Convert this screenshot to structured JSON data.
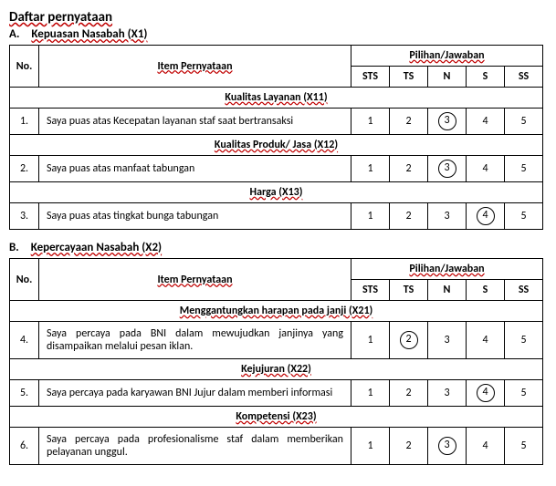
{
  "title": "Daftar pernyataan",
  "header": {
    "no": "No.",
    "item": "Item Pernyataan",
    "options_header": "Pilihan/Jawaban",
    "options": [
      "STS",
      "TS",
      "N",
      "S",
      "SS"
    ]
  },
  "scale": [
    "1",
    "2",
    "3",
    "4",
    "5"
  ],
  "sections": [
    {
      "letter": "A.",
      "title": "Kepuasan Nasabah (X1)",
      "groups": [
        {
          "subtitle": "Kualitas Layanan (X11)",
          "rows": [
            {
              "no": "1.",
              "text": "Saya puas atas Kecepatan  layanan staf saat bertransaksi",
              "circled": 3
            }
          ]
        },
        {
          "subtitle": "Kualitas Produk/ Jasa (X12)",
          "rows": [
            {
              "no": "2.",
              "text": "Saya puas atas manfaat tabungan",
              "circled": 3
            }
          ]
        },
        {
          "subtitle": "Harga (X13)",
          "rows": [
            {
              "no": "3.",
              "text": "Saya puas atas tingkat bunga tabungan",
              "circled": 4
            }
          ]
        }
      ]
    },
    {
      "letter": "B.",
      "title": "Kepercayaan Nasabah (X2)",
      "groups": [
        {
          "subtitle": "Menggantungkan harapan pada janji (X21)",
          "rows": [
            {
              "no": "4.",
              "text": "Saya percaya pada BNI dalam mewujudkan janjinya yang disampaikan melalui pesan iklan.",
              "circled": 2
            }
          ]
        },
        {
          "subtitle": "Kejujuran (X22)",
          "rows": [
            {
              "no": "5.",
              "text": "Saya percaya pada karyawan BNI Jujur dalam memberi informasi",
              "circled": 4
            }
          ]
        },
        {
          "subtitle": "Kompetensi (X23)",
          "rows": [
            {
              "no": "6.",
              "text": "Saya percaya pada profesionalisme staf dalam memberikan pelayanan unggul.",
              "circled": 3
            }
          ]
        }
      ]
    }
  ]
}
